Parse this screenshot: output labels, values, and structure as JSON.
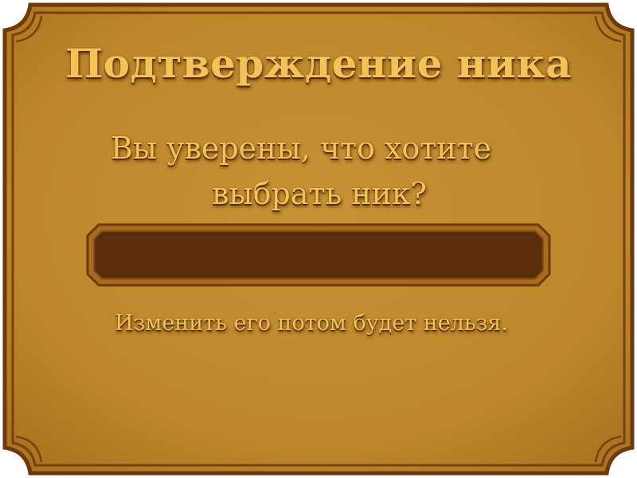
{
  "dialog": {
    "title": "Подтверждение ника",
    "question_line1": "Вы уверены, что хотите",
    "question_line2": "выбрать ник?",
    "nickname_value": "",
    "warning": "Изменить его потом будет нельзя."
  },
  "colors": {
    "panel": "#c08a2c",
    "panel_border": "#7b3f10",
    "input_fill": "#5b2d0c",
    "text": "#f3c35a"
  }
}
